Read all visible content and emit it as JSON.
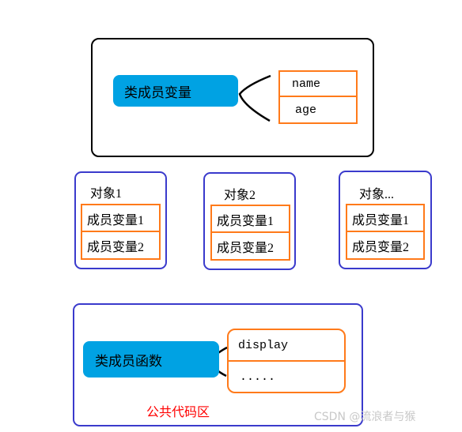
{
  "class_box": {
    "label": "类成员变量",
    "members": [
      "name",
      "age"
    ]
  },
  "objects": [
    {
      "title": "对象1",
      "members": [
        "成员变量1",
        "成员变量2"
      ]
    },
    {
      "title": "对象2",
      "members": [
        "成员变量1",
        "成员变量2"
      ]
    },
    {
      "title": "对象...",
      "members": [
        "成员变量1",
        "成员变量2"
      ]
    }
  ],
  "code_area": {
    "label": "类成员函数",
    "functions": [
      "display",
      "....."
    ],
    "caption": "公共代码区",
    "caption_color": "#ff0000"
  },
  "colors": {
    "pill": "#00a2e3",
    "table_border": "#ff7a1a",
    "object_border": "#3a3acc"
  },
  "watermark": "CSDN @流浪者与猴"
}
